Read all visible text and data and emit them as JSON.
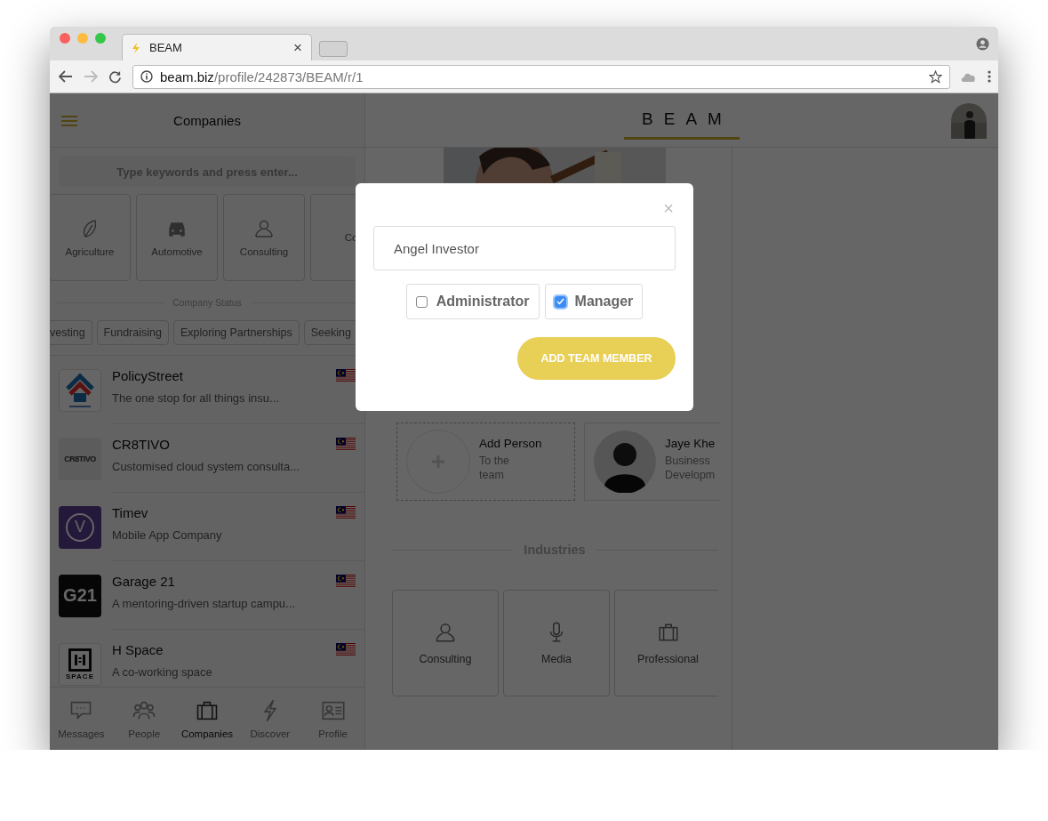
{
  "browser": {
    "tab_title": "BEAM",
    "tab_close": "×",
    "url_host": "beam.biz",
    "url_path": "/profile/242873/BEAM/r/1"
  },
  "sidebar": {
    "title": "Companies",
    "search": {
      "placeholder": "Type keywords and press enter..."
    },
    "categories": [
      {
        "label": "Agriculture"
      },
      {
        "label": "Automotive"
      },
      {
        "label": "Consulting"
      },
      {
        "label": "Co"
      }
    ],
    "status_heading": "Company Status",
    "status_chips": [
      "vesting",
      "Fundraising",
      "Exploring Partnerships",
      "Seeking"
    ],
    "companies": [
      {
        "name": "PolicyStreet",
        "description": "The one stop for all things insu..."
      },
      {
        "name": "CR8TIVO",
        "description": "Customised cloud system consulta...",
        "logo_text": "CR8TIVO"
      },
      {
        "name": "Timev",
        "description": "Mobile App Company",
        "logo_text": "V"
      },
      {
        "name": "Garage 21",
        "description": "A mentoring-driven startup campu...",
        "logo_text": "G21"
      },
      {
        "name": "H Space",
        "description": "A co-working space",
        "logo_text": "SPACE"
      }
    ],
    "nav": [
      {
        "label": "Messages",
        "selected": false
      },
      {
        "label": "People",
        "selected": false
      },
      {
        "label": "Companies",
        "selected": true
      },
      {
        "label": "Discover",
        "selected": false
      },
      {
        "label": "Profile",
        "selected": false
      }
    ]
  },
  "header": {
    "logo": "BEAM"
  },
  "team": [
    {
      "kind": "add",
      "name": "Add Person",
      "subtitle": "To the team"
    },
    {
      "kind": "member",
      "name": "Jaye Khe",
      "subtitle": "Business Developm"
    }
  ],
  "industries": {
    "heading": "Industries",
    "items": [
      {
        "label": "Consulting"
      },
      {
        "label": "Media"
      },
      {
        "label": "Professional"
      }
    ]
  },
  "modal": {
    "close": "×",
    "role_field": {
      "value": "Angel Investor"
    },
    "options": [
      {
        "label": "Administrator",
        "checked": false
      },
      {
        "label": "Manager",
        "checked": true
      }
    ],
    "button": "ADD TEAM MEMBER"
  }
}
